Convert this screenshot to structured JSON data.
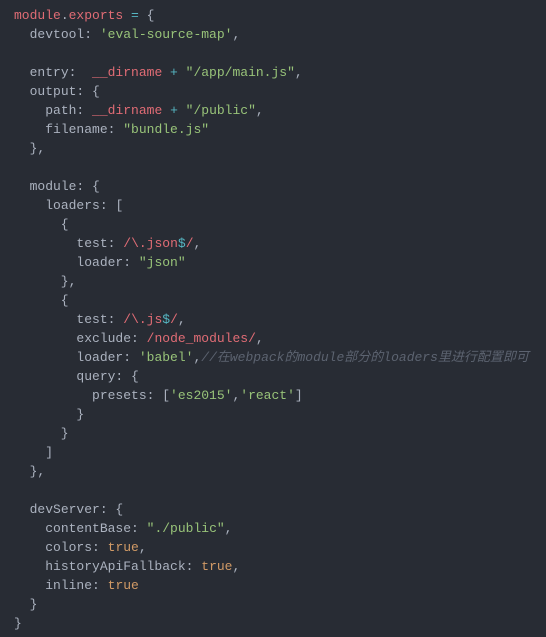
{
  "code": {
    "moduleExports": {
      "module": "module",
      "dot": ".",
      "exports": "exports"
    },
    "devtool": {
      "key": "devtool:",
      "val": "'eval-source-map'"
    },
    "entry": {
      "key": "entry:",
      "dirname": "__dirname",
      "plus": " + ",
      "path": "\"/app/main.js\""
    },
    "output": {
      "key": "output:",
      "path": {
        "key": "path:",
        "dirname": "__dirname",
        "plus": " + ",
        "val": "\"/public\""
      },
      "filename": {
        "key": "filename:",
        "val": "\"bundle.js\""
      }
    },
    "module": {
      "key": "module:",
      "loaders": {
        "key": "loaders:"
      },
      "loader0": {
        "test": {
          "key": "test:",
          "slashOpen": "/",
          "body": "\\.json",
          "dollar": "$",
          "slashClose": "/"
        },
        "loader": {
          "key": "loader:",
          "val": "\"json\""
        }
      },
      "loader1": {
        "test": {
          "key": "test:",
          "slashOpen": "/",
          "body": "\\.js",
          "dollar": "$",
          "slashClose": "/"
        },
        "exclude": {
          "key": "exclude:",
          "slashOpen": "/",
          "body": "node_modules",
          "slashClose": "/"
        },
        "loader": {
          "key": "loader:",
          "val": "'babel'",
          "comment": "//在webpack的module部分的loaders里进行配置即可"
        },
        "query": {
          "key": "query:",
          "presets": {
            "key": "presets:",
            "v0": "'es2015'",
            "v1": "'react'"
          }
        }
      }
    },
    "devServer": {
      "key": "devServer:",
      "contentBase": {
        "key": "contentBase:",
        "val": "\"./public\""
      },
      "colors": {
        "key": "colors:",
        "val": "true"
      },
      "historyApiFallback": {
        "key": "historyApiFallback:",
        "val": "true"
      },
      "inline": {
        "key": "inline:",
        "val": "true"
      }
    }
  }
}
